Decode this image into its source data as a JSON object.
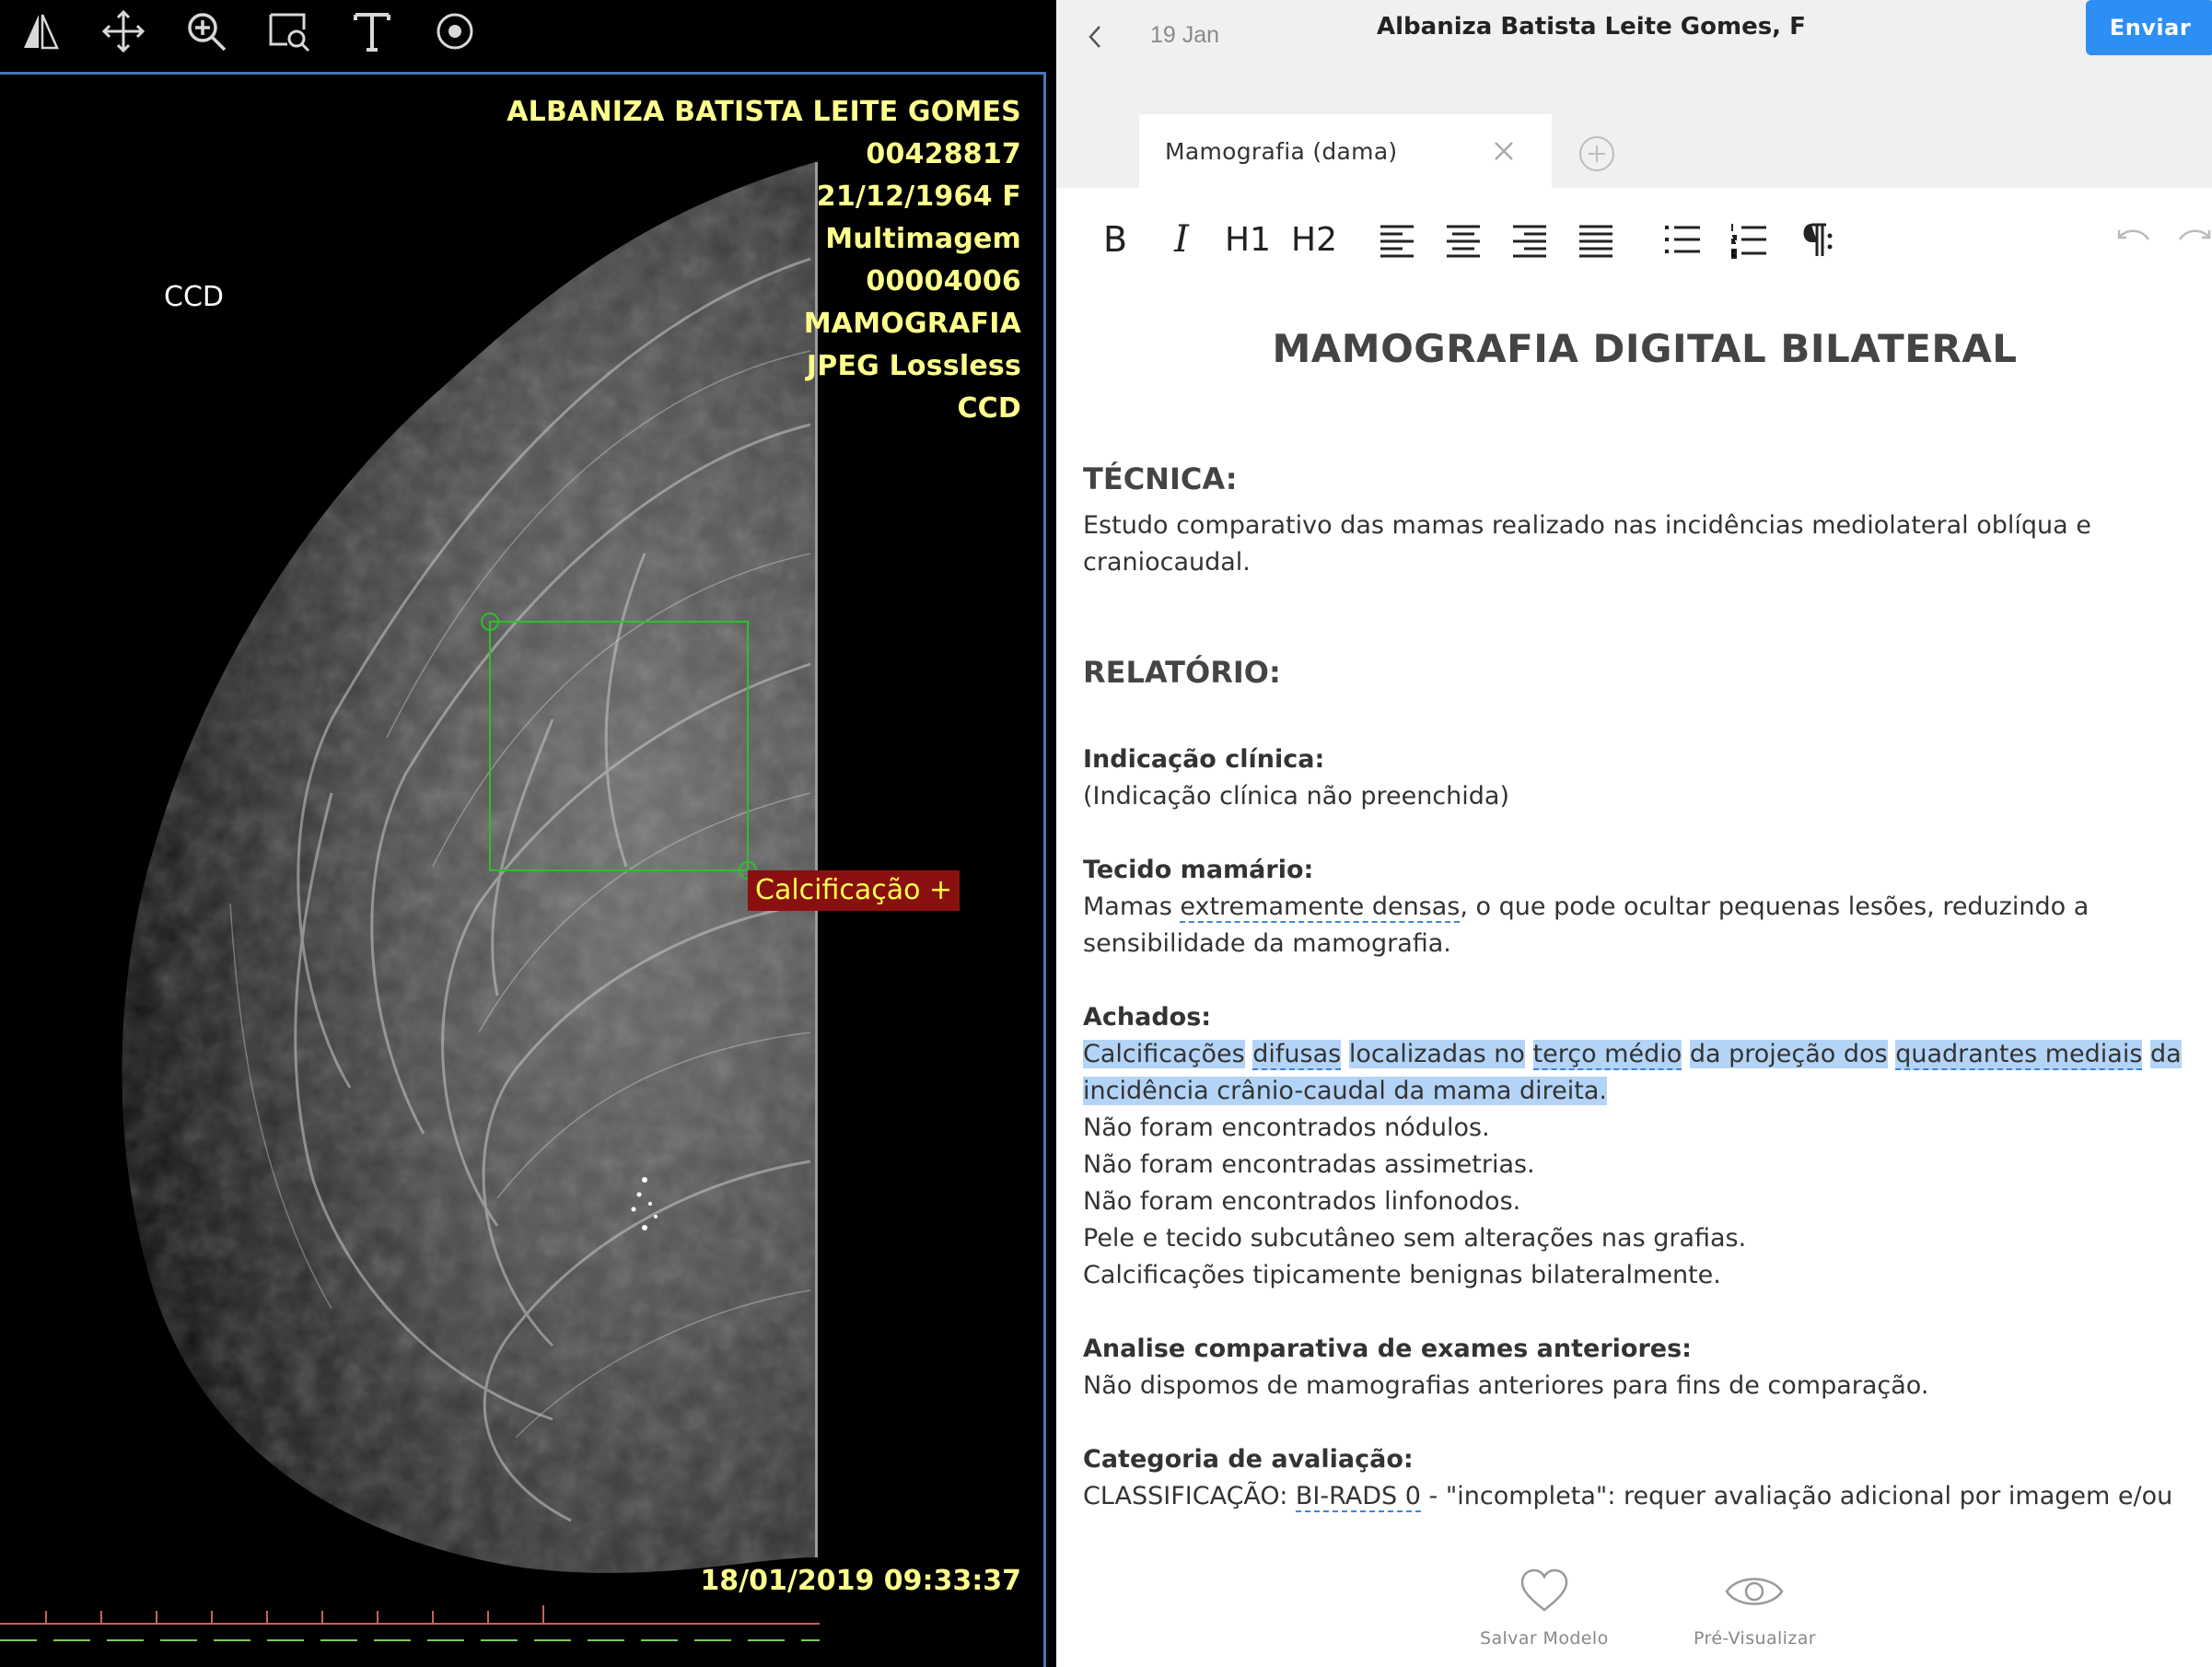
{
  "viewer": {
    "toolbar": {
      "icons": [
        "flip-icon",
        "pan-icon",
        "zoom-icon",
        "magnify-region-icon",
        "text-tool-icon",
        "roi-circle-icon"
      ]
    },
    "overlay_lines": [
      "ALBANIZA BATISTA LEITE GOMES",
      "00428817",
      "21/12/1964 F",
      "Multimagem",
      "00004006",
      "MAMOGRAFIA",
      "JPEG Lossless",
      "CCD"
    ],
    "orientation_label": "CCD",
    "timestamp": "18/01/2019 09:33:37",
    "annotation_label": "Calcificação +",
    "colors": {
      "overlay_text": "#ffff8c",
      "roi": "#2fbf2f",
      "annotation_bg": "#8a1010",
      "annotation_text": "#ffff50",
      "border": "#4a74b5"
    }
  },
  "editor": {
    "header": {
      "date": "19 Jan",
      "patient": "Albaniza Batista Leite Gomes, F",
      "send_label": "Enviar"
    },
    "tabs": [
      {
        "label": "Mamografia (dama)",
        "active": true
      }
    ],
    "format_toolbar": {
      "bold": "B",
      "italic": "I",
      "h1": "H1",
      "h2": "H2"
    },
    "document": {
      "title": "MAMOGRAFIA DIGITAL BILATERAL",
      "tecnica_heading": "TÉCNICA:",
      "tecnica_text": "Estudo comparativo das mamas realizado nas incidências mediolateral oblíqua e craniocaudal.",
      "relatorio_heading": "RELATÓRIO:",
      "indicacao_heading": "Indicação clínica:",
      "indicacao_text": "(Indicação clínica não preenchida)",
      "tecido_heading": "Tecido mamário:",
      "tecido_pre": "Mamas ",
      "tecido_dash": "extremamente densas",
      "tecido_post": ", o que pode ocultar pequenas lesões, reduzindo a sensibilidade da mamografia.",
      "achados_heading": "Achados:",
      "achados_hl": {
        "w1": "Calcificações",
        "w2": "difusas",
        "w3": "localizadas no",
        "w4": "terço médio",
        "w5": "da projeção dos",
        "w6": "quadrantes mediais",
        "w7": "da incidência crânio-caudal da mama direita."
      },
      "achados_lines": [
        "Não foram encontrados nódulos.",
        "Não foram encontradas assimetrias.",
        "Não foram encontrados linfonodos.",
        "Pele e tecido subcutâneo sem alterações nas grafias.",
        "Calcificações tipicamente benignas bilateralmente."
      ],
      "analise_heading": "Analise comparativa de exames anteriores:",
      "analise_text": "Não dispomos de mamografias anteriores para fins de comparação.",
      "categoria_heading": "Categoria de avaliação:",
      "categoria_pre": "CLASSIFICAÇÃO: ",
      "categoria_dash": "BI-RADS 0",
      "categoria_post": " - \"incompleta\": requer avaliação adicional por imagem e/ou"
    },
    "bottom": {
      "save_label": "Salvar Modelo",
      "preview_label": "Pré-Visualizar"
    },
    "colors": {
      "accent": "#2d8ff5",
      "highlight": "#b3d4f7",
      "spellcheck": "#3e86d8"
    }
  }
}
